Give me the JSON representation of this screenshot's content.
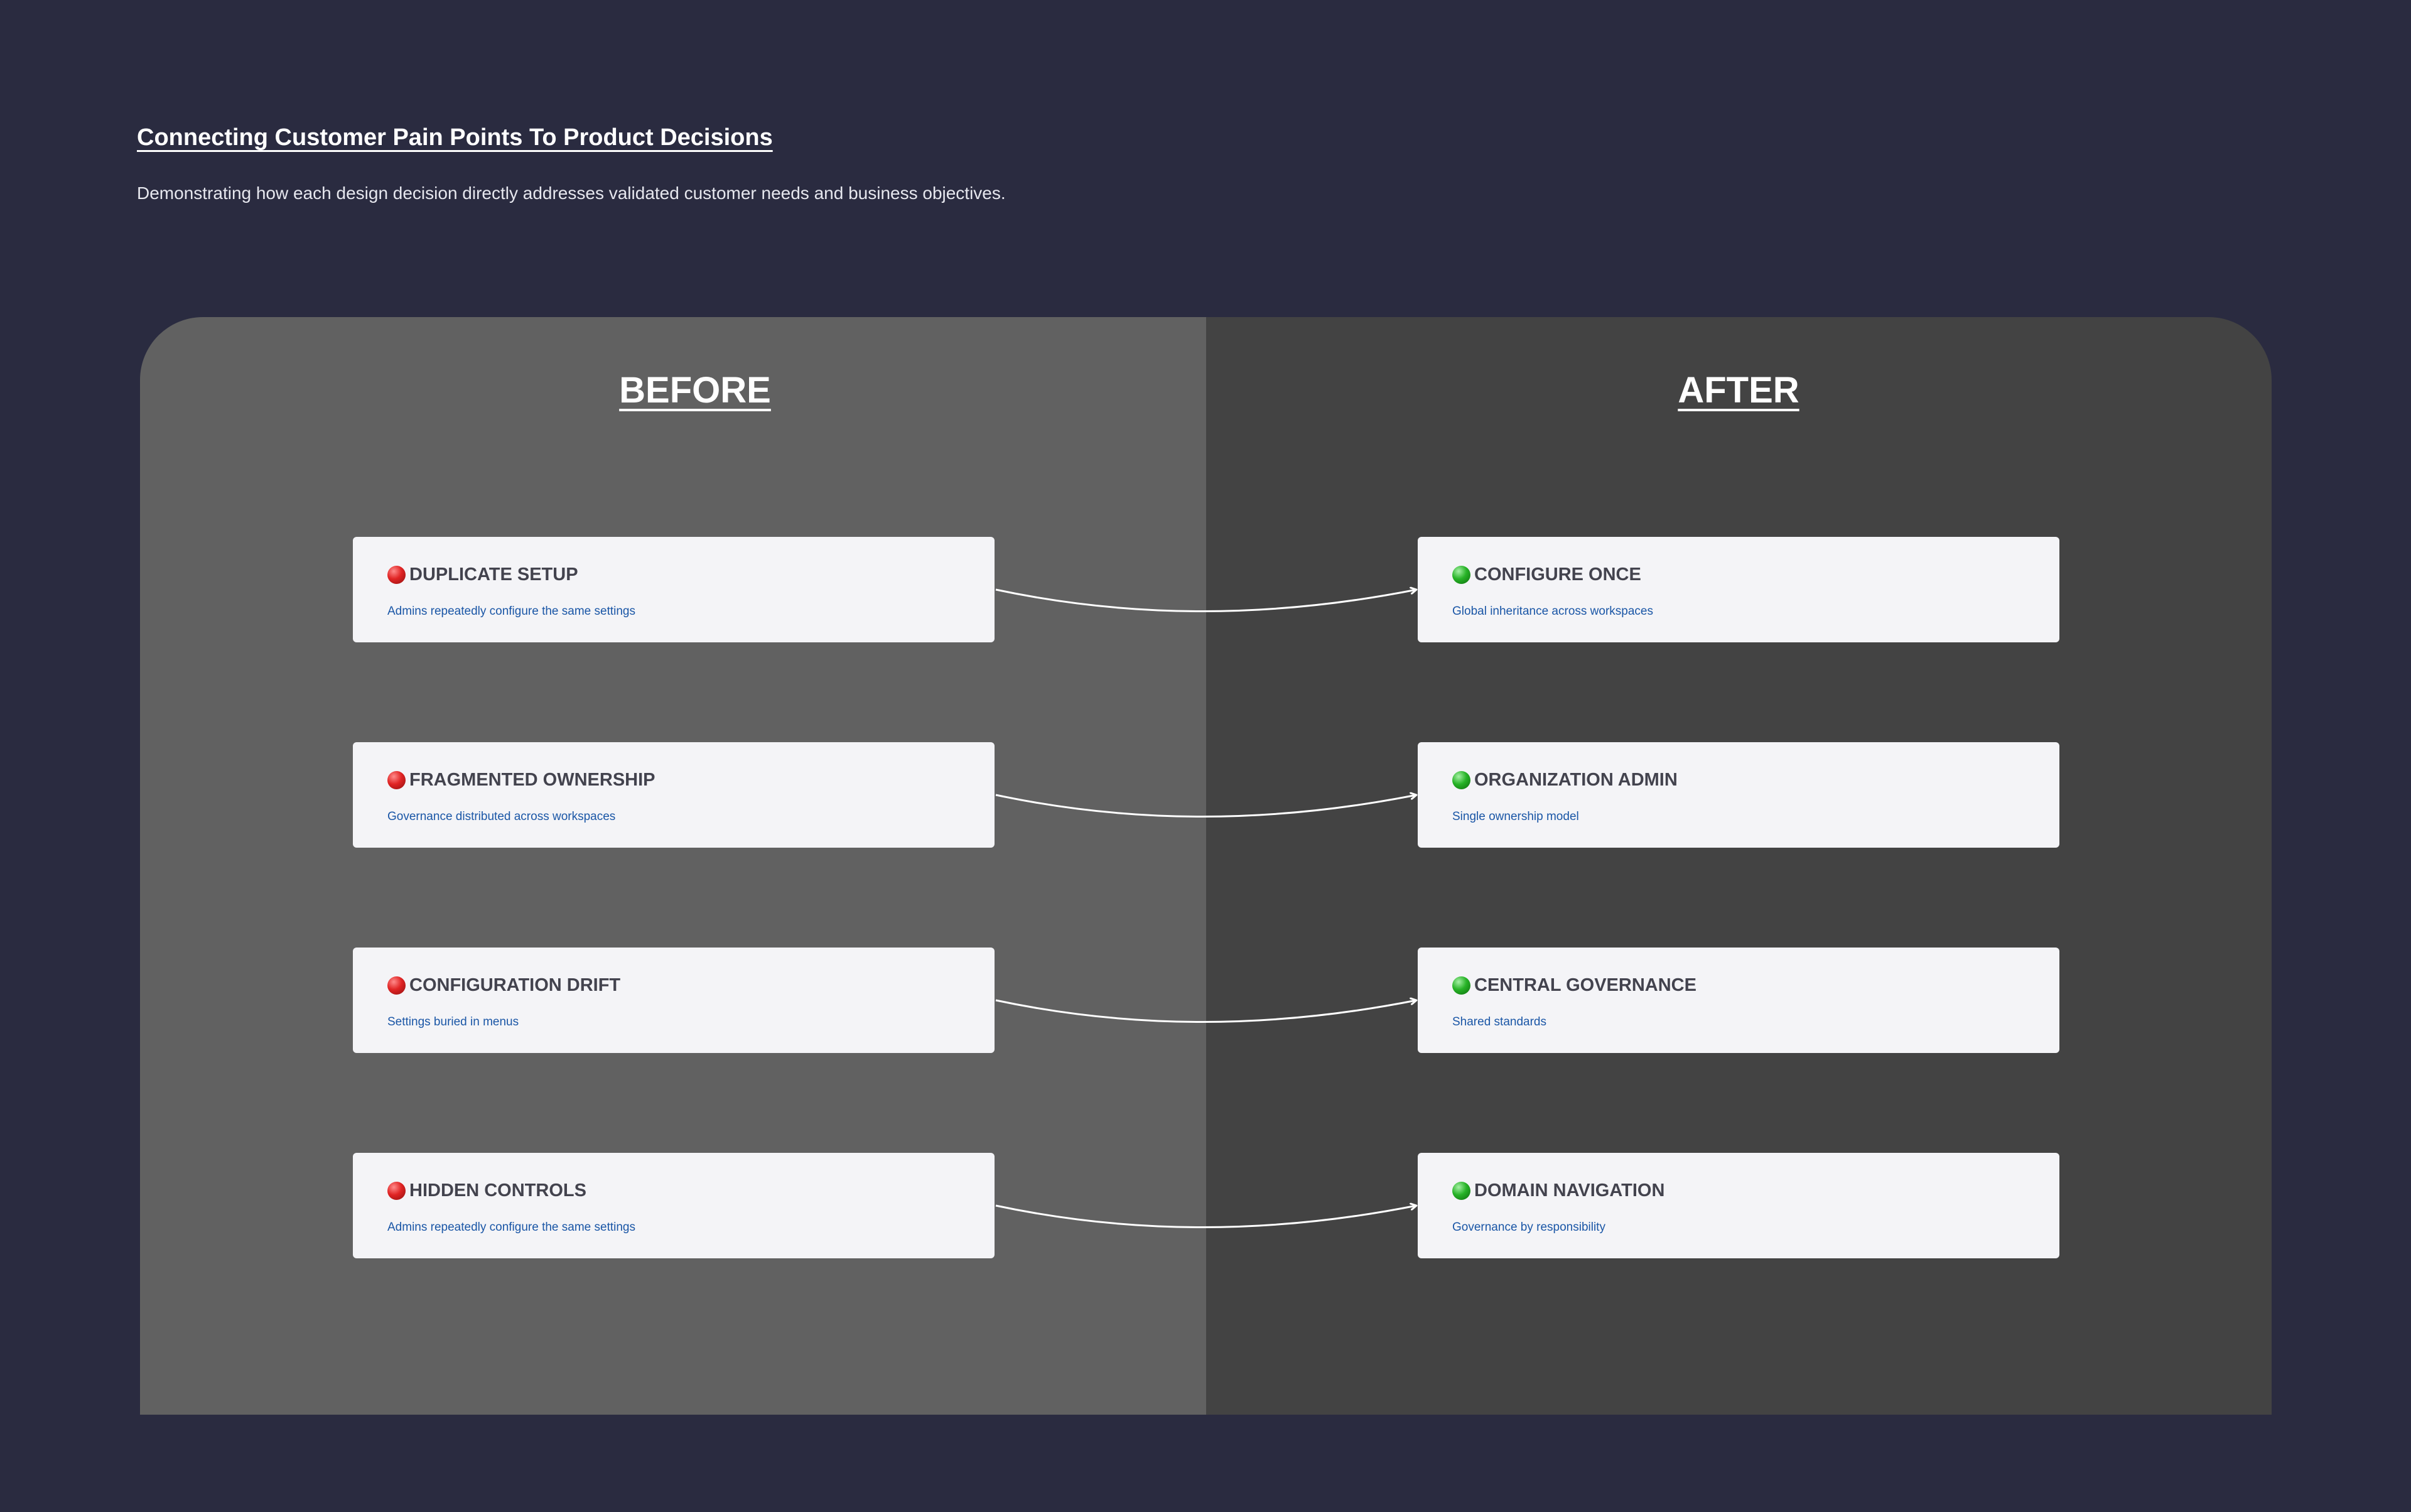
{
  "header": {
    "title": "Connecting Customer Pain Points To Product Decisions",
    "subtitle": "Demonstrating how each design decision directly addresses validated customer needs and business objectives."
  },
  "columns": {
    "before": "BEFORE",
    "after": "AFTER"
  },
  "colors": {
    "background": "#2a2b40",
    "before_panel": "#616161",
    "after_panel": "#434343",
    "card": "#f4f4f7",
    "card_title": "#43434e",
    "card_desc": "#1a56a6",
    "problem_dot": "#e02424",
    "solution_dot": "#27b327"
  },
  "before": [
    {
      "title": "DUPLICATE SETUP",
      "desc": "Admins repeatedly configure the same settings",
      "icon": "red-circle-icon"
    },
    {
      "title": "FRAGMENTED OWNERSHIP",
      "desc": "Governance distributed across workspaces",
      "icon": "red-circle-icon"
    },
    {
      "title": "CONFIGURATION DRIFT",
      "desc": "Settings buried in menus",
      "icon": "red-circle-icon"
    },
    {
      "title": "HIDDEN CONTROLS",
      "desc": "Admins repeatedly configure the same settings",
      "icon": "red-circle-icon"
    }
  ],
  "after": [
    {
      "title": "CONFIGURE ONCE",
      "desc": "Global inheritance across workspaces",
      "icon": "green-circle-icon"
    },
    {
      "title": "ORGANIZATION ADMIN",
      "desc": "Single ownership model",
      "icon": "green-circle-icon"
    },
    {
      "title": "CENTRAL GOVERNANCE",
      "desc": "Shared standards",
      "icon": "green-circle-icon"
    },
    {
      "title": "DOMAIN NAVIGATION",
      "desc": "Governance by responsibility",
      "icon": "green-circle-icon"
    }
  ]
}
